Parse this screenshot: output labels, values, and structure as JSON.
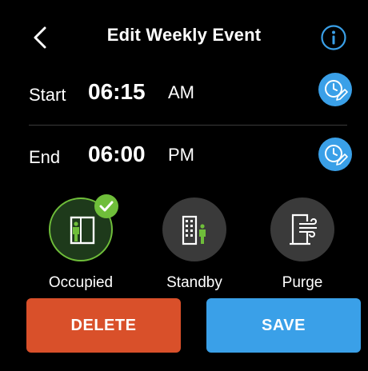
{
  "header": {
    "title": "Edit Weekly Event",
    "back_icon": "chevron-left-icon",
    "info_icon": "info-icon"
  },
  "start": {
    "label": "Start",
    "time": "06:15",
    "ampm": "AM",
    "edit_icon": "clock-edit-icon"
  },
  "end": {
    "label": "End",
    "time": "06:00",
    "ampm": "PM",
    "edit_icon": "clock-edit-icon"
  },
  "modes": [
    {
      "label": "Occupied",
      "icon": "occupied-icon",
      "selected": true
    },
    {
      "label": "Standby",
      "icon": "standby-icon",
      "selected": false
    },
    {
      "label": "Purge",
      "icon": "purge-icon",
      "selected": false
    }
  ],
  "actions": {
    "delete_label": "DELETE",
    "save_label": "SAVE"
  },
  "colors": {
    "background": "#000000",
    "accent_blue": "#3aa0e8",
    "delete_orange": "#d9502a",
    "selected_green": "#6fbe3a",
    "mode_gray": "#3a3a3a"
  }
}
